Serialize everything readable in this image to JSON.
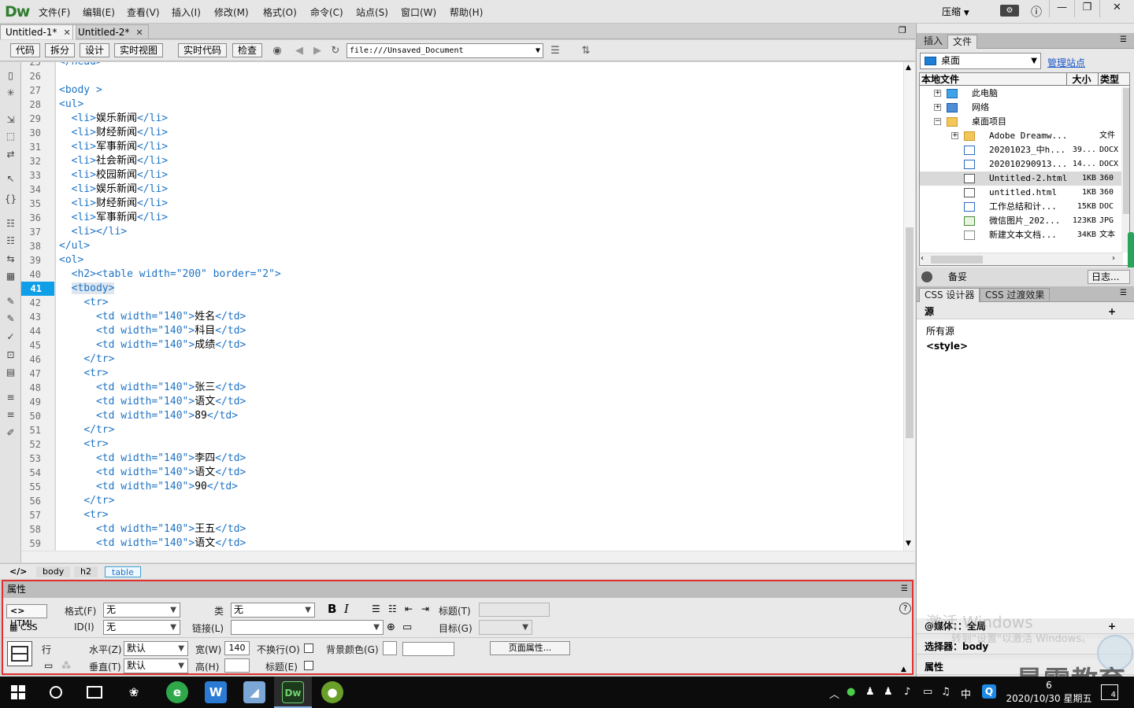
{
  "app": {
    "logo": "Dw"
  },
  "menu": [
    "文件(F)",
    "编辑(E)",
    "查看(V)",
    "插入(I)",
    "修改(M)",
    "格式(O)",
    "命令(C)",
    "站点(S)",
    "窗口(W)",
    "帮助(H)"
  ],
  "window": {
    "compact": "压缩",
    "minimize": "—",
    "restore": "❐",
    "close": "✕",
    "help_icon": "ⓘ"
  },
  "doc_tabs": [
    {
      "label": "Untitled-1*"
    },
    {
      "label": "Untitled-2*"
    }
  ],
  "toolbar": {
    "code": "代码",
    "split": "拆分",
    "design": "设计",
    "live_view": "实时视图",
    "live_code": "实时代码",
    "inspect": "检查",
    "address": "file:///Unsaved_Document"
  },
  "gutter": [
    "25",
    "26",
    "27",
    "28",
    "29",
    "30",
    "31",
    "32",
    "33",
    "34",
    "35",
    "36",
    "37",
    "38",
    "39",
    "40",
    "41",
    "42",
    "43",
    "44",
    "45",
    "46",
    "47",
    "48",
    "49",
    "50",
    "51",
    "52",
    "53",
    "54",
    "55",
    "56",
    "57",
    "58",
    "59"
  ],
  "current_line": "41",
  "code_lines": [
    [
      [
        "tag",
        "</head>"
      ]
    ],
    [],
    [
      [
        "tag",
        "<body >"
      ]
    ],
    [
      [
        "tag",
        "<ul>"
      ]
    ],
    [
      [
        "txt",
        "  "
      ],
      [
        "tag",
        "<li>"
      ],
      [
        "txt",
        "娱乐新闻"
      ],
      [
        "tag",
        "</li>"
      ]
    ],
    [
      [
        "txt",
        "  "
      ],
      [
        "tag",
        "<li>"
      ],
      [
        "txt",
        "财经新闻"
      ],
      [
        "tag",
        "</li>"
      ]
    ],
    [
      [
        "txt",
        "  "
      ],
      [
        "tag",
        "<li>"
      ],
      [
        "txt",
        "军事新闻"
      ],
      [
        "tag",
        "</li>"
      ]
    ],
    [
      [
        "txt",
        "  "
      ],
      [
        "tag",
        "<li>"
      ],
      [
        "txt",
        "社会新闻"
      ],
      [
        "tag",
        "</li>"
      ]
    ],
    [
      [
        "txt",
        "  "
      ],
      [
        "tag",
        "<li>"
      ],
      [
        "txt",
        "校园新闻"
      ],
      [
        "tag",
        "</li>"
      ]
    ],
    [
      [
        "txt",
        "  "
      ],
      [
        "tag",
        "<li>"
      ],
      [
        "txt",
        "娱乐新闻"
      ],
      [
        "tag",
        "</li>"
      ]
    ],
    [
      [
        "txt",
        "  "
      ],
      [
        "tag",
        "<li>"
      ],
      [
        "txt",
        "财经新闻"
      ],
      [
        "tag",
        "</li>"
      ]
    ],
    [
      [
        "txt",
        "  "
      ],
      [
        "tag",
        "<li>"
      ],
      [
        "txt",
        "军事新闻"
      ],
      [
        "tag",
        "</li>"
      ]
    ],
    [
      [
        "txt",
        "  "
      ],
      [
        "tag",
        "<li></li>"
      ]
    ],
    [
      [
        "tag",
        "</ul>"
      ]
    ],
    [
      [
        "tag",
        "<ol>"
      ]
    ],
    [
      [
        "txt",
        "  "
      ],
      [
        "tag",
        "<h2><table width=\"200\" border=\"2\">"
      ]
    ],
    [
      [
        "txt",
        "  "
      ],
      [
        "hl",
        "<tbody>"
      ]
    ],
    [
      [
        "txt",
        "    "
      ],
      [
        "tag",
        "<tr>"
      ]
    ],
    [
      [
        "txt",
        "      "
      ],
      [
        "tag",
        "<td width=\"140\">"
      ],
      [
        "txt",
        "姓名"
      ],
      [
        "tag",
        "</td>"
      ]
    ],
    [
      [
        "txt",
        "      "
      ],
      [
        "tag",
        "<td width=\"140\">"
      ],
      [
        "txt",
        "科目"
      ],
      [
        "tag",
        "</td>"
      ]
    ],
    [
      [
        "txt",
        "      "
      ],
      [
        "tag",
        "<td width=\"140\">"
      ],
      [
        "txt",
        "成绩"
      ],
      [
        "tag",
        "</td>"
      ]
    ],
    [
      [
        "txt",
        "    "
      ],
      [
        "tag",
        "</tr>"
      ]
    ],
    [
      [
        "txt",
        "    "
      ],
      [
        "tag",
        "<tr>"
      ]
    ],
    [
      [
        "txt",
        "      "
      ],
      [
        "tag",
        "<td width=\"140\">"
      ],
      [
        "txt",
        "张三"
      ],
      [
        "tag",
        "</td>"
      ]
    ],
    [
      [
        "txt",
        "      "
      ],
      [
        "tag",
        "<td width=\"140\">"
      ],
      [
        "txt",
        "语文"
      ],
      [
        "tag",
        "</td>"
      ]
    ],
    [
      [
        "txt",
        "      "
      ],
      [
        "tag",
        "<td width=\"140\">"
      ],
      [
        "txt",
        "89"
      ],
      [
        "tag",
        "</td>"
      ]
    ],
    [
      [
        "txt",
        "    "
      ],
      [
        "tag",
        "</tr>"
      ]
    ],
    [
      [
        "txt",
        "    "
      ],
      [
        "tag",
        "<tr>"
      ]
    ],
    [
      [
        "txt",
        "      "
      ],
      [
        "tag",
        "<td width=\"140\">"
      ],
      [
        "txt",
        "李四"
      ],
      [
        "tag",
        "</td>"
      ]
    ],
    [
      [
        "txt",
        "      "
      ],
      [
        "tag",
        "<td width=\"140\">"
      ],
      [
        "txt",
        "语文"
      ],
      [
        "tag",
        "</td>"
      ]
    ],
    [
      [
        "txt",
        "      "
      ],
      [
        "tag",
        "<td width=\"140\">"
      ],
      [
        "txt",
        "90"
      ],
      [
        "tag",
        "</td>"
      ]
    ],
    [
      [
        "txt",
        "    "
      ],
      [
        "tag",
        "</tr>"
      ]
    ],
    [
      [
        "txt",
        "    "
      ],
      [
        "tag",
        "<tr>"
      ]
    ],
    [
      [
        "txt",
        "      "
      ],
      [
        "tag",
        "<td width=\"140\">"
      ],
      [
        "txt",
        "王五"
      ],
      [
        "tag",
        "</td>"
      ]
    ],
    [
      [
        "txt",
        "      "
      ],
      [
        "tag",
        "<td width=\"140\">"
      ],
      [
        "txt",
        "语文"
      ],
      [
        "tag",
        "</td>"
      ]
    ]
  ],
  "tag_selector": {
    "root": "</>",
    "crumbs": [
      "body",
      "h2",
      "table"
    ]
  },
  "props": {
    "title": "属性",
    "html_mode": "HTML",
    "css_mode": "CSS",
    "format_label": "格式(F)",
    "format_value": "无",
    "class_label": "类",
    "class_value": "无",
    "id_label": "ID(I)",
    "id_value": "无",
    "link_label": "链接(L)",
    "heading_label": "标题(T)",
    "target_label": "目标(G)",
    "bold": "B",
    "italic": "I",
    "row_label": "行",
    "horz_label": "水平(Z)",
    "horz_value": "默认",
    "vert_label": "垂直(T)",
    "vert_value": "默认",
    "width_label": "宽(W)",
    "width_value": "140",
    "height_label": "高(H)",
    "nowrap_label": "不换行(O)",
    "header_label": "标题(E)",
    "bg_label": "背景颜色(G)",
    "page_props": "页面属性...",
    "help": "?"
  },
  "right": {
    "tabs": [
      "插入",
      "文件"
    ],
    "site": "桌面",
    "manage": "管理站点",
    "file_cols": {
      "name": "本地文件",
      "size": "大小",
      "type": "类型"
    },
    "files": [
      {
        "name": "此电脑",
        "size": "",
        "type": "",
        "indent": 0,
        "toggle": "+",
        "icon": "pc"
      },
      {
        "name": "网络",
        "size": "",
        "type": "",
        "indent": 0,
        "toggle": "+",
        "icon": "net"
      },
      {
        "name": "桌面项目",
        "size": "",
        "type": "",
        "indent": 0,
        "toggle": "−",
        "icon": "folder"
      },
      {
        "name": "Adobe Dreamw...",
        "size": "",
        "type": "文件",
        "indent": 1,
        "toggle": "+",
        "icon": "folder"
      },
      {
        "name": "20201023_中h...",
        "size": "39...",
        "type": "DOCX",
        "indent": 1,
        "toggle": "",
        "icon": "doc"
      },
      {
        "name": "202010290913...",
        "size": "14...",
        "type": "DOCX",
        "indent": 1,
        "toggle": "",
        "icon": "doc"
      },
      {
        "name": "Untitled-2.html",
        "size": "1KB",
        "type": "360",
        "indent": 1,
        "toggle": "",
        "icon": "html",
        "selected": true
      },
      {
        "name": "untitled.html",
        "size": "1KB",
        "type": "360",
        "indent": 1,
        "toggle": "",
        "icon": "html"
      },
      {
        "name": "工作总结和计...",
        "size": "15KB",
        "type": "DOC",
        "indent": 1,
        "toggle": "",
        "icon": "doc"
      },
      {
        "name": "微信图片_202...",
        "size": "123KB",
        "type": "JPG",
        "indent": 1,
        "toggle": "",
        "icon": "img"
      },
      {
        "name": "新建文本文档...",
        "size": "34KB",
        "type": "文本",
        "indent": 1,
        "toggle": "",
        "icon": "txt"
      }
    ],
    "footer_label": "备妥",
    "log_btn": "日志...",
    "css_tabs": [
      "CSS 设计器",
      "CSS 过渡效果"
    ],
    "source_head": "源",
    "source_all": "所有源",
    "source_style": "<style>",
    "media_label": "@媒体：：全局",
    "selector_label": "选择器：body",
    "props_label": "属性"
  },
  "watermark": {
    "line1": "激活 Windows",
    "line2": "转到\"设置\"以激活 Windows。",
    "brand": "最需教育"
  },
  "taskbar": {
    "time": "6",
    "date": "2020/10/30 星期五",
    "ime": "中",
    "notif_count": "4"
  }
}
